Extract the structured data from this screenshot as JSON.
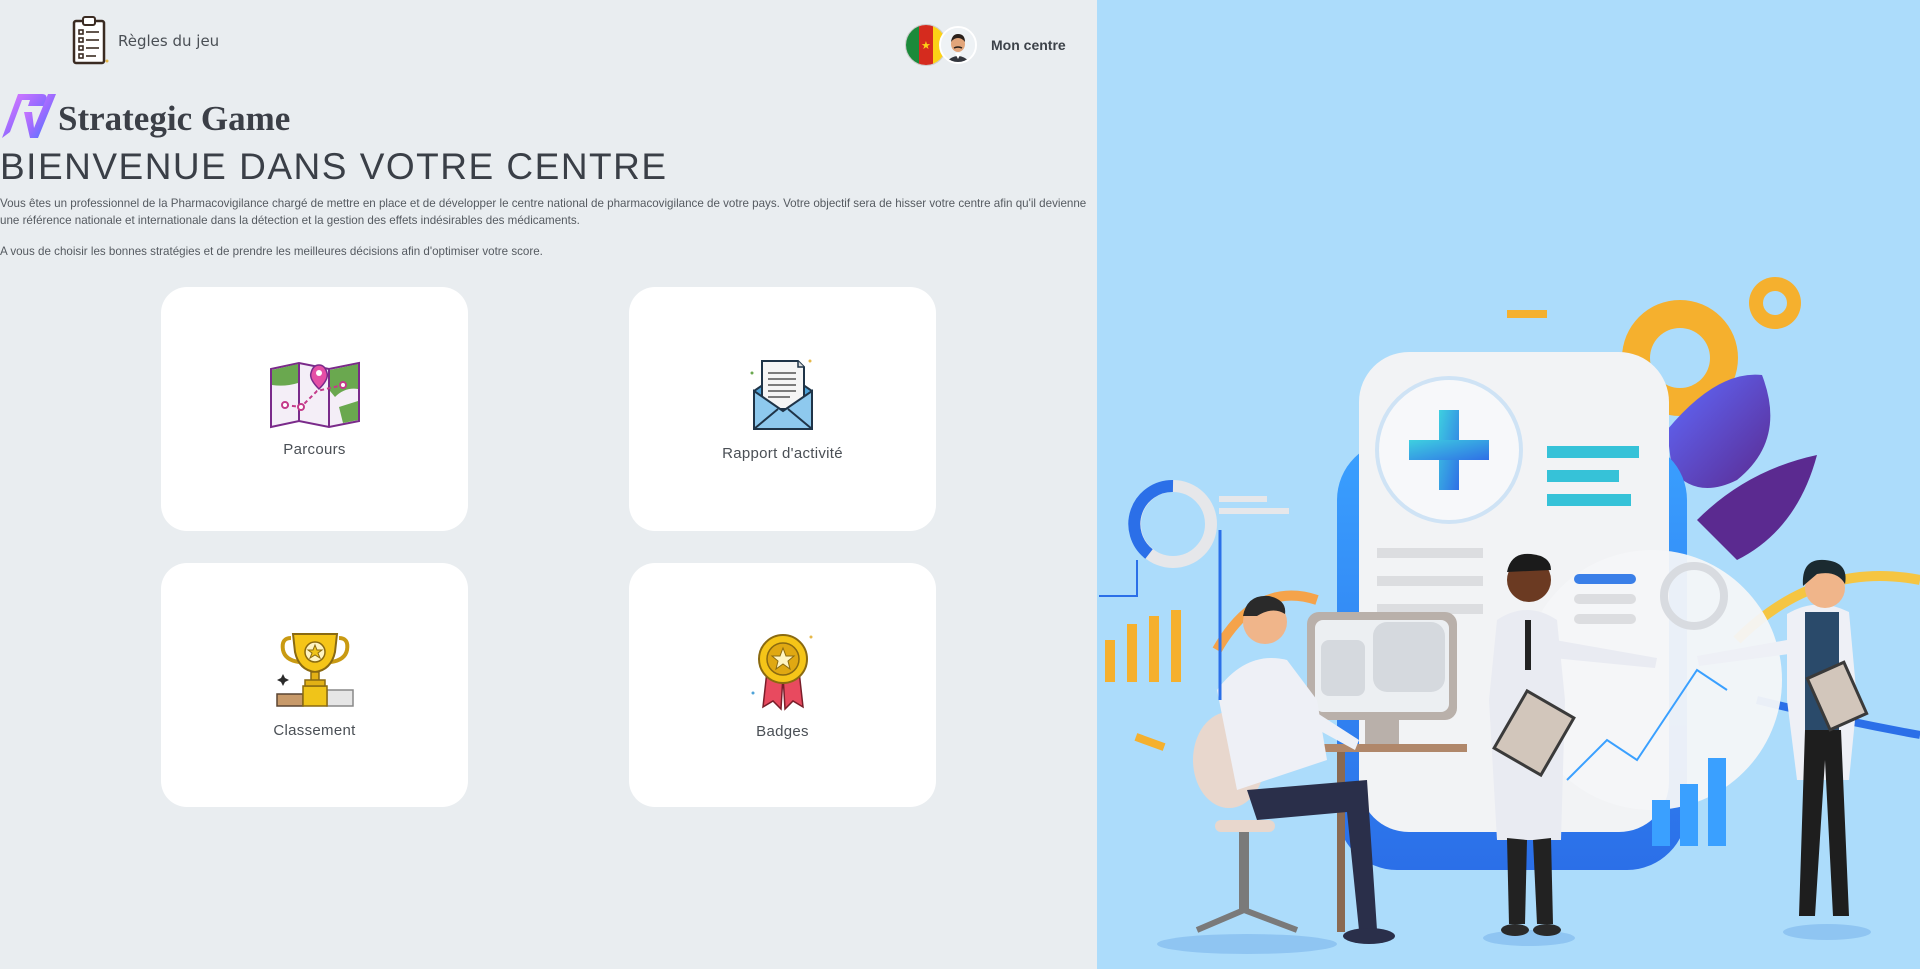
{
  "header": {
    "rules_label": "Règles du jeu",
    "user_label": "Mon centre"
  },
  "brand": {
    "name": "Strategic Game"
  },
  "main": {
    "title": "BIENVENUE DANS VOTRE CENTRE",
    "intro": "Vous êtes un professionnel de la Pharmacovigilance chargé de mettre en place et de développer le centre national de pharmacovigilance de votre pays. Votre objectif sera de hisser votre centre afin qu'il devienne une référence nationale et internationale dans la détection et la gestion des effets indésirables des médicaments.",
    "intro2": "A vous de choisir les bonnes stratégies et de prendre les meilleures décisions afin d'optimiser votre score."
  },
  "cards": [
    {
      "label": "Parcours",
      "icon": "map-icon"
    },
    {
      "label": "Rapport d'activité",
      "icon": "envelope-report-icon"
    },
    {
      "label": "Classement",
      "icon": "trophy-icon"
    },
    {
      "label": "Badges",
      "icon": "medal-icon"
    }
  ],
  "colors": {
    "left_bg": "#e9edf0",
    "right_bg": "#acdcfb",
    "card_bg": "#ffffff",
    "brand_gradient_start": "#d46bff",
    "brand_gradient_end": "#2f7cff"
  }
}
